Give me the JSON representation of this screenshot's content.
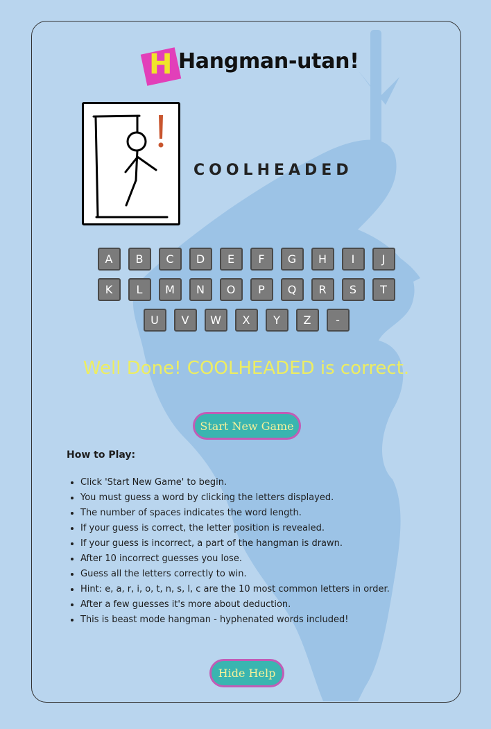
{
  "header": {
    "logo_letter": "H",
    "title": "Hangman-utan!"
  },
  "game": {
    "word": "COOLHEADED",
    "result_message": "Well Done! COOLHEADED is correct."
  },
  "keyboard": {
    "row1": [
      "A",
      "B",
      "C",
      "D",
      "E",
      "F",
      "G",
      "H",
      "I",
      "J"
    ],
    "row2": [
      "K",
      "L",
      "M",
      "N",
      "O",
      "P",
      "Q",
      "R",
      "S",
      "T"
    ],
    "row3": [
      "U",
      "V",
      "W",
      "X",
      "Y",
      "Z",
      "-"
    ]
  },
  "buttons": {
    "start_new_game": "Start New Game",
    "hide_help": "Hide Help"
  },
  "help": {
    "title": "How to Play:",
    "rules": [
      "Click 'Start New Game' to begin.",
      "You must guess a word by clicking the letters displayed.",
      "The number of spaces indicates the word length.",
      "If your guess is correct, the letter position is revealed.",
      "If your guess is incorrect, a part of the hangman is drawn.",
      "After 10 incorrect guesses you lose.",
      "Guess all the letters correctly to win.",
      "Hint: e, a, r, i, o, t, n, s, l, c are the 10 most common letters in order.",
      "After a few guesses it's more about deduction.",
      "This is beast mode hangman - hyphenated words included!"
    ]
  },
  "colors": {
    "background": "#b9d5ee",
    "key": "#7b7b7b",
    "button": "#3ab5b0",
    "button_border": "#c25cb6",
    "result_text": "#eded62",
    "logo_box": "#e23fb9",
    "logo_letter": "#f0e52a"
  }
}
